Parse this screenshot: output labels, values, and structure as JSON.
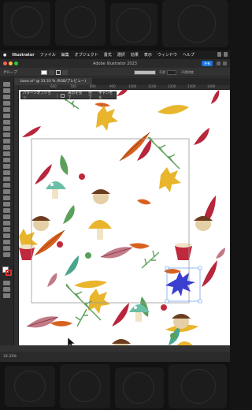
{
  "menubar": {
    "app_name": "Illustrator",
    "items": [
      "ファイル",
      "編集",
      "オブジェクト",
      "書式",
      "選択",
      "効果",
      "表示",
      "ウィンドウ",
      "ヘルプ"
    ]
  },
  "titlebar": {
    "title": "Adobe Illustrator 2023",
    "share_label": "共有"
  },
  "controlbar": {
    "selection_label": "グループ",
    "stroke_width_placeholder": "",
    "opacity_label": "不透",
    "opacity_value": "不透明度"
  },
  "document_tab": {
    "label": "base.ai* @ 33.33 % (RGB/プレビュー)"
  },
  "ruler": {
    "ticks": [
      "600",
      "700",
      "800",
      "900",
      "1000",
      "1100",
      "1200",
      "1300",
      "1400",
      "1500"
    ]
  },
  "pattern_bar": {
    "title": "パターンオプション",
    "items": [
      "表示を完了",
      "完了",
      "キャンセル"
    ]
  },
  "statusbar": {
    "zoom": "33.33%"
  },
  "colors": {
    "accent": "#1473e6",
    "canvas": "#ffffff",
    "ui_dark": "#323232",
    "leaf_red": "#b8263c",
    "leaf_orange": "#d9611f",
    "leaf_yellow": "#e8b52c",
    "leaf_green": "#5aa05a",
    "leaf_teal": "#4aa58e",
    "leaf_pink": "#c27a86",
    "selection": "#3a3fd0"
  }
}
